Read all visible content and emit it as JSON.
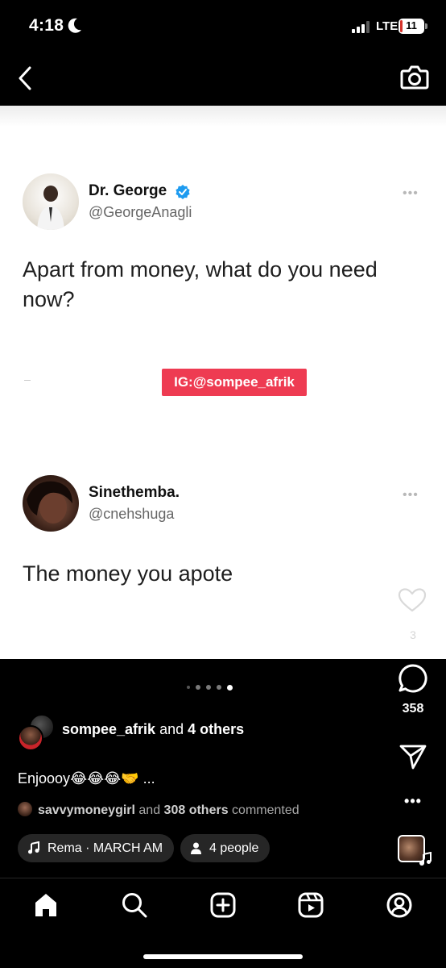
{
  "status_bar": {
    "time": "4:18",
    "network": "LTE",
    "battery": "11",
    "battery_fraction": 0.11
  },
  "post_image": {
    "tweets": [
      {
        "name": "Dr. George",
        "handle": "@GeorgeAnagli",
        "verified": true,
        "text": "Apart from money, what do you need now?",
        "more": "•••"
      },
      {
        "name": "Sinethemba.",
        "handle": "@cnehshuga",
        "verified": false,
        "text": "The money you apote",
        "more": "•••"
      }
    ],
    "watermark": "IG:@sompee_afrik",
    "like_count": "3",
    "watermark_color": "#ee3b52"
  },
  "actions": {
    "comment_count": "358",
    "more": "•••"
  },
  "carousel": {
    "total": 5,
    "active_index": 4
  },
  "caption": {
    "likes_user": "sompee_afrik",
    "likes_and": " and ",
    "likes_others": "4 others",
    "text": "Enjoooy",
    "emoji": "😂😂😂🤝",
    "ellipsis": " ...",
    "commenter": "savvymoneygirl",
    "comment_and": " and ",
    "comment_others": "308 others",
    "comment_suffix": " commented"
  },
  "audio_pill": {
    "label": "Rema · MARCH AM"
  },
  "people_pill": {
    "label": "4 people"
  },
  "tabs": [
    "home-icon",
    "search-icon",
    "create-icon",
    "reels-icon",
    "profile-icon"
  ]
}
